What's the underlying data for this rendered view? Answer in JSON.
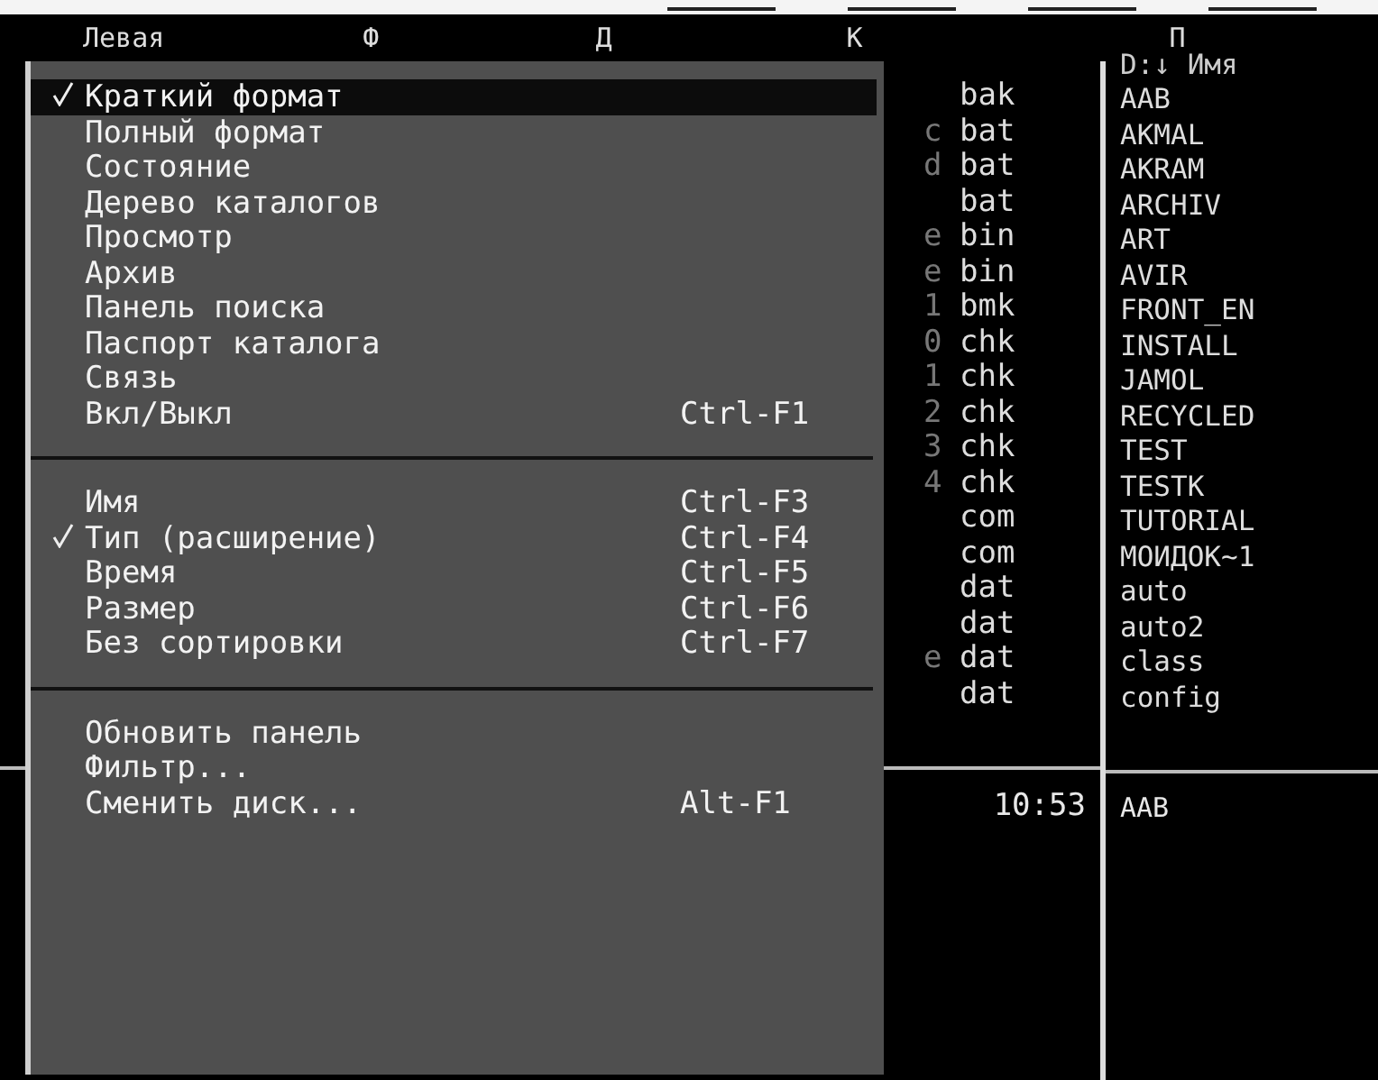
{
  "menu_bar": [
    {
      "label": "Левая"
    },
    {
      "label": "Ф"
    },
    {
      "label": "Д"
    },
    {
      "label": "К"
    },
    {
      "label": "П"
    }
  ],
  "menu": [
    {
      "kind": "item",
      "label": "Краткий формат",
      "checked": true,
      "selected": true
    },
    {
      "kind": "item",
      "label": "Полный формат",
      "checked": false,
      "selected": false
    },
    {
      "kind": "item",
      "label": "Состояние",
      "checked": false,
      "selected": false
    },
    {
      "kind": "item",
      "label": "Дерево каталогов",
      "checked": false,
      "selected": false
    },
    {
      "kind": "item",
      "label": "Просмотр",
      "checked": false,
      "selected": false
    },
    {
      "kind": "item",
      "label": "Архив",
      "checked": false,
      "selected": false
    },
    {
      "kind": "item",
      "label": "Панель поиска",
      "checked": false,
      "selected": false
    },
    {
      "kind": "item",
      "label": "Паспорт каталога",
      "checked": false,
      "selected": false
    },
    {
      "kind": "item",
      "label": "Связь",
      "checked": false,
      "selected": false
    },
    {
      "kind": "item",
      "label": "Вкл/Выкл",
      "shortcut": "Ctrl-F1",
      "checked": false,
      "selected": false
    },
    {
      "kind": "separator"
    },
    {
      "kind": "item",
      "label": "Имя",
      "shortcut": "Ctrl-F3",
      "checked": false,
      "selected": false
    },
    {
      "kind": "item",
      "label": "Тип (расширение)",
      "shortcut": "Ctrl-F4",
      "checked": true,
      "selected": false
    },
    {
      "kind": "item",
      "label": "Время",
      "shortcut": "Ctrl-F5",
      "checked": false,
      "selected": false
    },
    {
      "kind": "item",
      "label": "Размер",
      "shortcut": "Ctrl-F6",
      "checked": false,
      "selected": false
    },
    {
      "kind": "item",
      "label": "Без сортировки",
      "shortcut": "Ctrl-F7",
      "checked": false,
      "selected": false
    },
    {
      "kind": "separator"
    },
    {
      "kind": "item",
      "label": "Обновить панель",
      "checked": false,
      "selected": false
    },
    {
      "kind": "item",
      "label": "Фильтр...",
      "checked": false,
      "selected": false
    },
    {
      "kind": "item",
      "label": "Сменить диск...",
      "shortcut": "Alt-F1",
      "checked": false,
      "selected": false
    }
  ],
  "left_panel": {
    "rows": [
      {
        "extension": "bak"
      },
      {
        "fragment": "c",
        "extension": "bat"
      },
      {
        "fragment": "d",
        "extension": "bat"
      },
      {
        "extension": "bat"
      },
      {
        "fragment": "e",
        "extension": "bin"
      },
      {
        "fragment": "e",
        "extension": "bin"
      },
      {
        "fragment": "1",
        "extension": "bmk"
      },
      {
        "fragment": "0",
        "extension": "chk"
      },
      {
        "fragment": "1",
        "extension": "chk"
      },
      {
        "fragment": "2",
        "extension": "chk"
      },
      {
        "fragment": "3",
        "extension": "chk"
      },
      {
        "fragment": "4",
        "extension": "chk"
      },
      {
        "extension": "com"
      },
      {
        "extension": "com"
      },
      {
        "extension": "dat"
      },
      {
        "extension": "dat"
      },
      {
        "fragment": "e",
        "extension": "dat"
      },
      {
        "extension": "dat"
      }
    ],
    "footer": "10:53"
  },
  "right_panel": {
    "header": "D:↓ Имя",
    "files": [
      "AAB",
      "AKMAL",
      "AKRAM",
      "ARCHIV",
      "ART",
      "AVIR",
      "FRONT_EN",
      "INSTALL",
      "JAMOL",
      "RECYCLED",
      "TEST",
      "TESTK",
      "TUTORIAL",
      "МОИДОК~1",
      "auto",
      "auto2",
      "class",
      "config"
    ],
    "footer": "AAB"
  }
}
